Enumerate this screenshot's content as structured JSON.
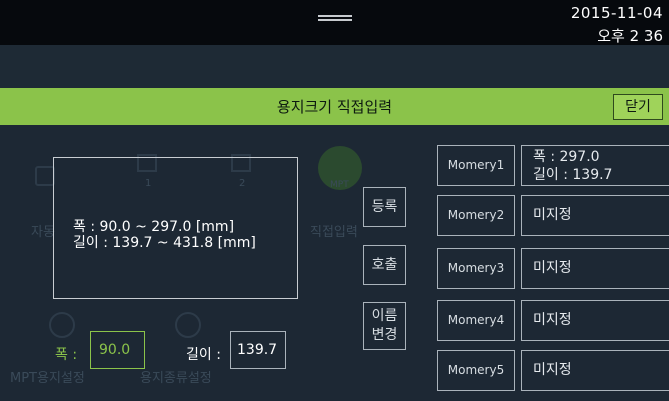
{
  "status_bar": {
    "date": "2015-11-04",
    "time": "오후 2 36"
  },
  "background_ghost": {
    "labels": [
      "자동",
      "1",
      "2",
      "MPT",
      "직접입력",
      "MPT용지설정",
      "용지종류설정"
    ]
  },
  "dialog": {
    "title": "용지크기 직접입력",
    "close_label": "닫기",
    "range_width": "폭 : 90.0 ~ 297.0 [mm]",
    "range_length": "길이 : 139.7 ~ 431.8 [mm]",
    "buttons": {
      "register": "등록",
      "recall": "호출",
      "rename_line1": "이름",
      "rename_line2": "변경"
    },
    "width_label": "폭 :",
    "width_value": "90.0",
    "length_label": "길이 :",
    "length_value": "139.7",
    "memories": [
      {
        "label": "Momery1",
        "line1": "폭 : 297.0",
        "line2": "길이 : 139.7"
      },
      {
        "label": "Momery2",
        "value": "미지정"
      },
      {
        "label": "Momery3",
        "value": "미지정"
      },
      {
        "label": "Momery4",
        "value": "미지정"
      },
      {
        "label": "Momery5",
        "value": "미지정"
      }
    ]
  }
}
